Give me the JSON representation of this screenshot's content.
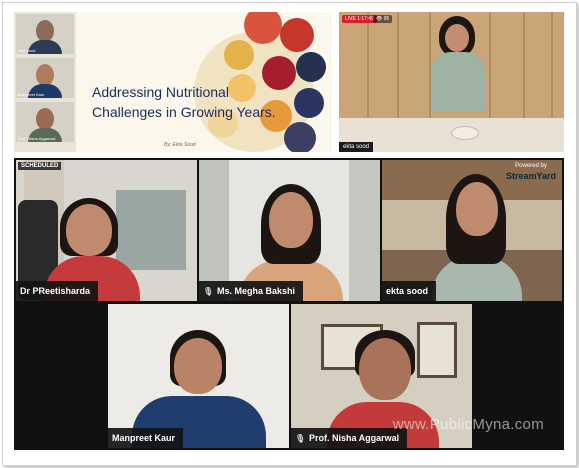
{
  "slide": {
    "title": "Addressing Nutritional Challenges in Growing Years.",
    "author": "By: Ekta Sood",
    "thumbs": [
      "ekta sood",
      "Manpreet Kaur",
      "Prof. Nisha Aggarwal"
    ]
  },
  "live_stream": {
    "live_badge": "LIVE 1:17:49",
    "viewers": "95",
    "presenter_name": "ekta sood"
  },
  "gallery": {
    "scheduled_badge": "SCHEDULED",
    "powered_by": "Powered by",
    "brand": "StreamYard",
    "participants": [
      {
        "name": "Dr PReetisharda",
        "mic": false
      },
      {
        "name": "Ms. Megha Bakshi",
        "mic": true
      },
      {
        "name": "ekta sood",
        "mic": false
      },
      {
        "name": "Manpreet Kaur",
        "mic": false
      },
      {
        "name": "Prof. Nisha Aggarwal",
        "mic": true
      }
    ]
  },
  "watermark": "www.PublicMyna.com",
  "colors": {
    "live_red": "#d61f26",
    "tag_bg": "#141414",
    "slide_title": "#1d2a5e"
  }
}
